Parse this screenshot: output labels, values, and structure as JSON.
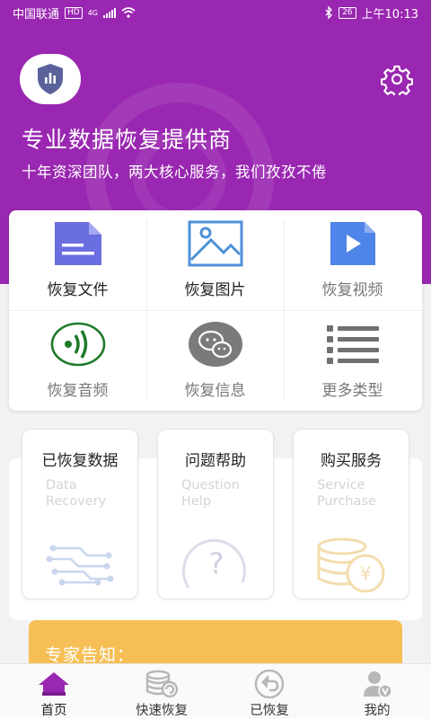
{
  "status_bar": {
    "carrier": "中国联通",
    "hd_badge": "HD",
    "network": "4G",
    "battery": "26",
    "time": "上午10:13"
  },
  "header": {
    "title": "专业数据恢复提供商",
    "subtitle": "十年资深团队，两大核心服务，我们孜孜不倦",
    "logo_icon": "shield-chart-icon",
    "settings_icon": "gear-icon"
  },
  "grid": {
    "items": [
      {
        "label": "恢复文件",
        "icon": "document-icon",
        "color": "#6b6ee0"
      },
      {
        "label": "恢复图片",
        "icon": "image-icon",
        "color": "#4f90d8"
      },
      {
        "label": "恢复视频",
        "icon": "video-icon",
        "color": "#4f84e8"
      },
      {
        "label": "恢复音频",
        "icon": "audio-icon",
        "color": "#1f7a2a"
      },
      {
        "label": "恢复信息",
        "icon": "chat-icon",
        "color": "#7a7a7a"
      },
      {
        "label": "更多类型",
        "icon": "list-icon",
        "color": "#707070"
      }
    ]
  },
  "services": [
    {
      "title": "已恢复数据",
      "en_line1": "Data",
      "en_line2": "Recovery",
      "icon": "circuit-icon"
    },
    {
      "title": "问题帮助",
      "en_line1": "Question",
      "en_line2": "Help",
      "icon": "question-icon"
    },
    {
      "title": "购买服务",
      "en_line1": "Service",
      "en_line2": "Purchase",
      "icon": "coins-icon"
    }
  ],
  "notice": {
    "title": "专家告知："
  },
  "tabbar": {
    "tabs": [
      {
        "label": "首页",
        "icon": "home-icon"
      },
      {
        "label": "快速恢复",
        "icon": "database-restore-icon"
      },
      {
        "label": "已恢复",
        "icon": "undo-icon"
      },
      {
        "label": "我的",
        "icon": "user-icon"
      }
    ]
  },
  "colors": {
    "brand": "#9a27b1",
    "notice": "#f6bf55",
    "active_tab": "#9a27b1"
  }
}
